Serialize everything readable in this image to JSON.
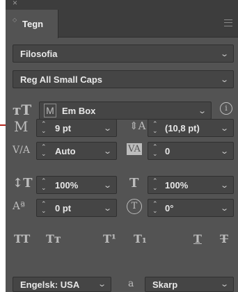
{
  "panel": {
    "tab_label": "Tegn"
  },
  "font": {
    "family": "Filosofia",
    "style": "Reg All Small Caps"
  },
  "grid": {
    "icon_label": "M",
    "value": "Em Box"
  },
  "size": {
    "value": "9 pt"
  },
  "leading": {
    "value": "(10,8 pt)"
  },
  "kerning": {
    "value": "Auto"
  },
  "tracking": {
    "value": "0"
  },
  "vscale": {
    "value": "100%"
  },
  "hscale": {
    "value": "100%"
  },
  "baseline": {
    "value": "0 pt"
  },
  "skew": {
    "value": "0°"
  },
  "language": {
    "value": "Engelsk: USA"
  },
  "antialias": {
    "icon_label": "a",
    "value": "Skarp"
  },
  "styles": {
    "all_caps": "TT",
    "small_caps": "Tт",
    "superscript": "T¹",
    "subscript": "T₁",
    "underline": "T",
    "strikethrough": "T"
  },
  "colors": {
    "panel_bg": "#535353",
    "field_bg": "#454545",
    "callout": "#b3261e"
  }
}
